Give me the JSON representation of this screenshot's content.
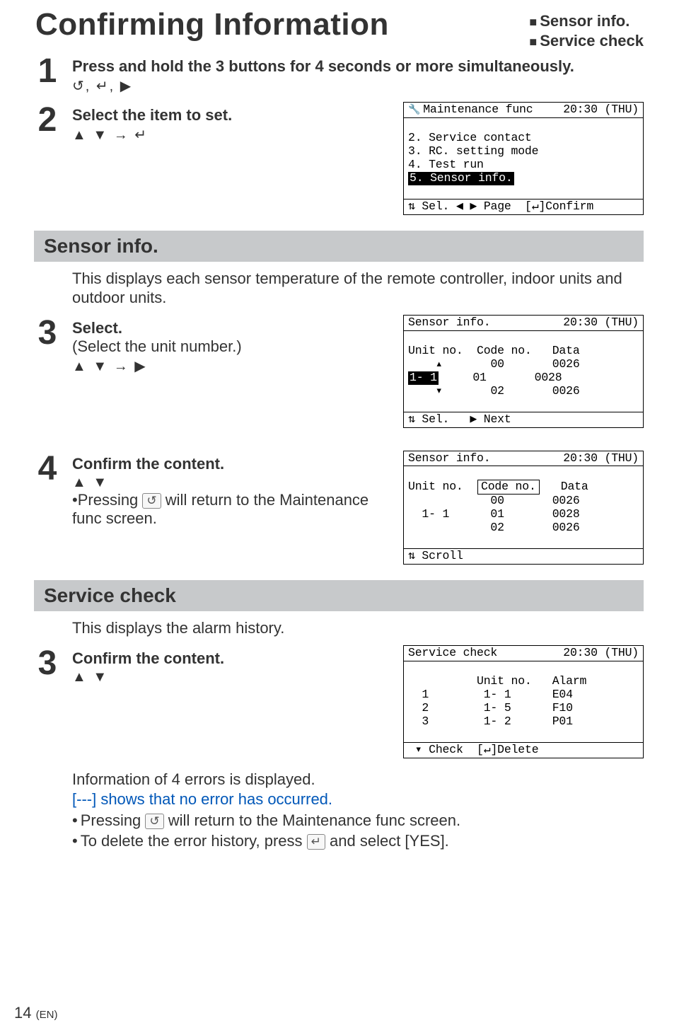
{
  "title": "Confirming Information",
  "top_bullets": [
    "Sensor info.",
    "Service check"
  ],
  "step1": {
    "no": "1",
    "text": "Press and hold the 3 buttons for 4 seconds or more simultaneously.",
    "keys": "↺, ↵, ▶"
  },
  "step2": {
    "no": "2",
    "text": "Select the item to set.",
    "keys": "▲ ▼ → ↵"
  },
  "lcd_maint": {
    "title_left": "Maintenance func",
    "title_right": "20:30 (THU)",
    "lines": [
      "2. Service contact",
      "3. RC. setting mode",
      "4. Test run"
    ],
    "hl": "5. Sensor info.",
    "foot": "⇅ Sel. ◀ ▶ Page  [↵]Confirm"
  },
  "bar_sensor": "Sensor info.",
  "sensor_desc": "This displays each sensor temperature of the remote controller, indoor units and outdoor units.",
  "step3a": {
    "no": "3",
    "bold": "Select.",
    "paren": "(Select the unit number.)",
    "keys": "▲ ▼ → ▶"
  },
  "lcd_sensor1": {
    "title_left": "Sensor info.",
    "title_right": "20:30 (THU)",
    "head": "Unit no.  Code no.   Data",
    "r_up": "    ▴       00       0026",
    "hl_unit": "1- 1",
    "r_mid_rest": "     01       0028",
    "r_dn": "    ▾       02       0026",
    "foot": "⇅ Sel.   ▶ Next"
  },
  "step4": {
    "no": "4",
    "bold": "Confirm the content.",
    "keys": "▲ ▼",
    "note_pre": "Pressing ",
    "note_post": " will return to the Maintenance func screen."
  },
  "lcd_sensor2": {
    "title_left": "Sensor info.",
    "title_right": "20:30 (THU)",
    "head_unit": "Unit no.",
    "head_code": "Code no.",
    "head_data": "Data",
    "r1": "            00       0026",
    "r2": "  1- 1      01       0028",
    "r3": "            02       0026",
    "foot": "⇅ Scroll"
  },
  "bar_service": "Service check",
  "service_desc": "This displays the alarm history.",
  "step3b": {
    "no": "3",
    "bold": "Confirm the content.",
    "keys": "▲ ▼"
  },
  "lcd_service": {
    "title_left": "Service check",
    "title_right": "20:30 (THU)",
    "head": "          Unit no.   Alarm",
    "r1": "  1        1- 1      E04",
    "r2": "  2        1- 5      F10",
    "r3": "  3        1- 2      P01",
    "foot": " ▾ Check  [↵]Delete"
  },
  "notes": {
    "l1": "Information of 4 errors is displayed.",
    "l2": "[---] shows that no error has occurred.",
    "b1_pre": "Pressing ",
    "b1_post": " will return to the Maintenance func screen.",
    "b2_pre": "To delete the error history, press ",
    "b2_post": " and select [YES]."
  },
  "pagenum": "14",
  "lang": "(EN)"
}
